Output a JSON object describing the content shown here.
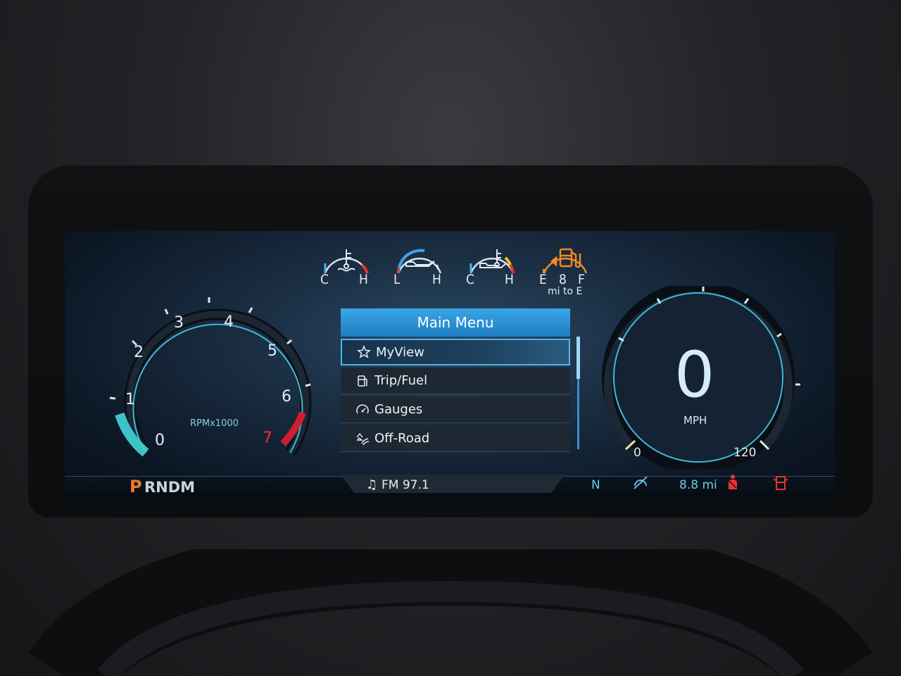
{
  "small_gauges": [
    {
      "icon": "coolant-temp-icon",
      "low": "C",
      "high": "H"
    },
    {
      "icon": "oil-pressure-icon",
      "low": "L",
      "high": "H"
    },
    {
      "icon": "transmission-temp-icon",
      "low": "C",
      "high": "H"
    },
    {
      "icon": "fuel-pump-icon",
      "low": "E",
      "value": "8",
      "high": "F",
      "sub": "mi to E"
    }
  ],
  "tachometer": {
    "ticks": [
      "0",
      "1",
      "2",
      "3",
      "4",
      "5",
      "6",
      "7"
    ],
    "unit": "RPMx1000"
  },
  "speedometer": {
    "value": "0",
    "unit": "MPH",
    "min": "0",
    "max": "120"
  },
  "menu": {
    "title": "Main Menu",
    "items": [
      {
        "label": "MyView",
        "icon": "star-icon",
        "selected": true
      },
      {
        "label": "Trip/Fuel",
        "icon": "fuel-icon"
      },
      {
        "label": "Gauges",
        "icon": "gauge-icon"
      },
      {
        "label": "Off-Road",
        "icon": "off-road-icon"
      }
    ]
  },
  "status_bar": {
    "gear_active": "P",
    "gear_rest": "RNDM",
    "media": "FM 97.1",
    "gear_indicator": "N",
    "distance": "8.8 mi"
  },
  "colors": {
    "accent": "#3aa6e6",
    "warning": "#e8332c",
    "fuel": "#f08a24",
    "gear_active": "#f07a28"
  }
}
